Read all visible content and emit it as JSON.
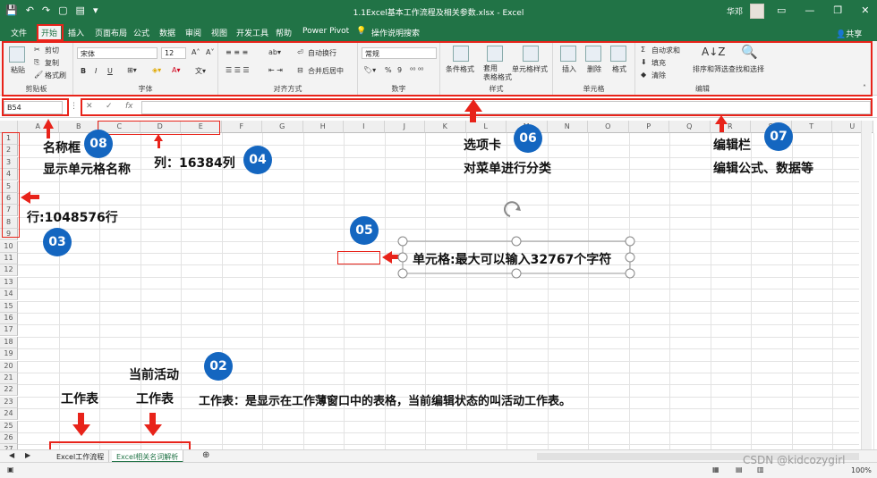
{
  "window": {
    "title": "1.1Excel基本工作流程及相关参数.xlsx - Excel",
    "user": "华邓",
    "share_label": "共享",
    "controls": [
      "▭",
      "—",
      "❐",
      "✕"
    ]
  },
  "tabs": [
    "文件",
    "开始",
    "插入",
    "页面布局",
    "公式",
    "数据",
    "审阅",
    "视图",
    "开发工具",
    "帮助",
    "Power Pivot",
    "操作说明搜索"
  ],
  "ribbon": {
    "clipboard": {
      "paste": "粘贴",
      "cut": "剪切",
      "copy": "复制",
      "format_painter": "格式刷",
      "label": "剪贴板"
    },
    "font": {
      "name": "宋体",
      "size": "12",
      "bold": "B",
      "italic": "I",
      "underline": "U",
      "label": "字体"
    },
    "alignment": {
      "wrap": "自动换行",
      "merge": "合并后居中",
      "label": "对齐方式"
    },
    "number": {
      "format": "常规",
      "percent": "%",
      "comma": "9",
      "label": "数字"
    },
    "styles": {
      "conditional": "条件格式",
      "table": "套用\n表格格式",
      "cell_styles": "单元格样式",
      "label": "样式"
    },
    "cells": {
      "insert": "插入",
      "delete": "删除",
      "format": "格式",
      "label": "单元格"
    },
    "editing": {
      "autosum": "自动求和",
      "fill": "填充",
      "clear": "清除",
      "sort": "排序和筛选",
      "find": "查找和选择",
      "label": "编辑"
    }
  },
  "formula_bar": {
    "name_box": "B54",
    "cancel": "✕",
    "enter": "✓",
    "fx": "fx",
    "value": ""
  },
  "grid": {
    "columns": [
      "A",
      "B",
      "C",
      "D",
      "E",
      "F",
      "G",
      "H",
      "I",
      "J",
      "K",
      "L",
      "M",
      "N",
      "O",
      "P",
      "Q",
      "R",
      "S",
      "T",
      "U"
    ],
    "rows": [
      "1",
      "2",
      "3",
      "4",
      "5",
      "6",
      "7",
      "8",
      "9",
      "10",
      "11",
      "12",
      "13",
      "14",
      "15",
      "16",
      "17",
      "18",
      "19",
      "20",
      "21",
      "22",
      "23",
      "24",
      "25",
      "26",
      "27"
    ]
  },
  "annotations": {
    "n02": "02",
    "n03": "03",
    "n04": "04",
    "n05": "05",
    "n06": "06",
    "n07": "07",
    "n08": "08",
    "namebox_title": "名称框",
    "namebox_desc": "显示单元格名称",
    "columns_text": "列：16384列",
    "rows_text": "行:1048576行",
    "cell_text": "单元格:最大可以输入32767个字符",
    "tabs_title": "选项卡",
    "tabs_desc": "对菜单进行分类",
    "editbar_title": "编辑栏",
    "editbar_desc": "编辑公式、数据等",
    "active_label": "当前活动",
    "sheet_label": "工作表",
    "sheet_label2": "工作表",
    "sheet_desc": "工作表：是显示在工作薄窗口中的表格，当前编辑状态的叫活动工作表。"
  },
  "sheets": [
    "Excel工作流程",
    "Excel相关名词解析"
  ],
  "watermark": "CSDN @kidcozygirl",
  "zoom": "100%",
  "colors": {
    "excel_green": "#217346",
    "annotation_red": "#e8231a",
    "badge_blue": "#1466c0"
  }
}
